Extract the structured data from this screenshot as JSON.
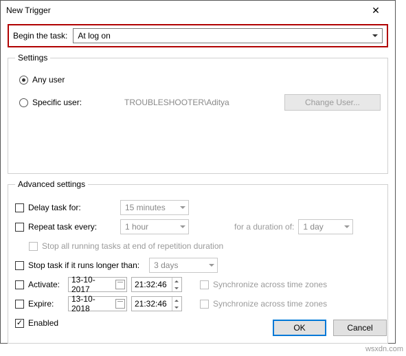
{
  "window": {
    "title": "New Trigger"
  },
  "begin": {
    "label": "Begin the task:",
    "value": "At log on"
  },
  "settings": {
    "legend": "Settings",
    "any_user": "Any user",
    "specific_user": "Specific user:",
    "user_value": "TROUBLESHOOTER\\Aditya",
    "change_user": "Change User..."
  },
  "advanced": {
    "legend": "Advanced settings",
    "delay_label": "Delay task for:",
    "delay_value": "15 minutes",
    "repeat_label": "Repeat task every:",
    "repeat_value": "1 hour",
    "duration_label": "for a duration of:",
    "duration_value": "1 day",
    "stop_all": "Stop all running tasks at end of repetition duration",
    "stop_if_label": "Stop task if it runs longer than:",
    "stop_if_value": "3 days",
    "activate_label": "Activate:",
    "activate_date": "13-10-2017",
    "activate_time": "21:32:46",
    "expire_label": "Expire:",
    "expire_date": "13-10-2018",
    "expire_time": "21:32:46",
    "sync1": "Synchronize across time zones",
    "sync2": "Synchronize across time zones",
    "enabled": "Enabled"
  },
  "footer": {
    "ok": "OK",
    "cancel": "Cancel"
  },
  "watermark": "wsxdn.com"
}
